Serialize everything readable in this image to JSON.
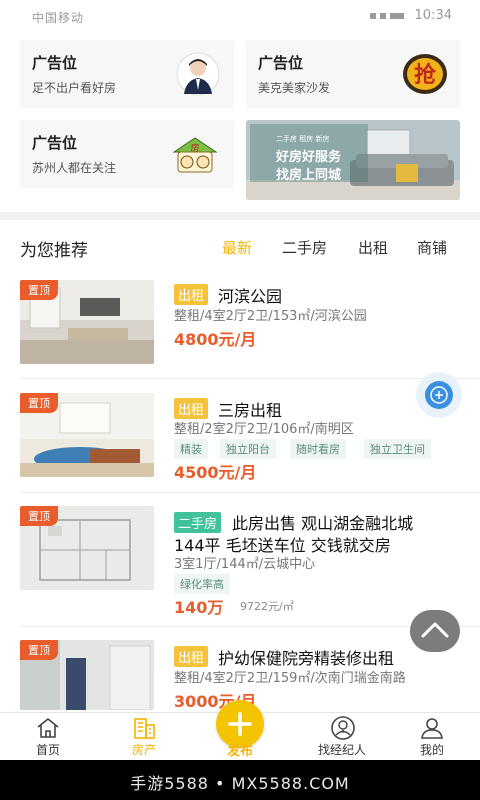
{
  "status_bar": {
    "left_text": "中国移动",
    "time": "10:34"
  },
  "ads": [
    {
      "title": "广告位",
      "subtitle": "足不出户看好房",
      "icon": "agent-portrait-icon"
    },
    {
      "title": "广告位",
      "subtitle": "美克美家沙发",
      "icon": "grab-badge-icon",
      "badge_char": "抢"
    },
    {
      "title": "广告位",
      "subtitle": "苏州人都在关注",
      "icon": "house-emoji-icon",
      "badge_char": "房"
    },
    {
      "banner_tags": "二手房  租房  新房",
      "banner_line1": "好房好服务",
      "banner_line2": "找房上同城"
    }
  ],
  "recommend": {
    "title": "为您推荐",
    "tabs": [
      "最新",
      "二手房",
      "出租",
      "商铺"
    ],
    "active_tab": 0
  },
  "listings": [
    {
      "top_tag": "置顶",
      "badge": "出租",
      "badge_type": "rent",
      "title": "河滨公园",
      "desc": "整租/4室2厅2卫/153㎡/河滨公园",
      "tags": [],
      "price": "4800元/月",
      "unit_price": ""
    },
    {
      "top_tag": "置顶",
      "badge": "出租",
      "badge_type": "rent",
      "title": "三房出租",
      "desc": "整租/2室2厅2卫/106㎡/南明区",
      "tags": [
        "精装",
        "独立阳台",
        "随时看房",
        "独立卫生间"
      ],
      "price": "4500元/月",
      "unit_price": ""
    },
    {
      "top_tag": "置顶",
      "badge": "二手房",
      "badge_type": "sale",
      "title": "此房出售 观山湖金融北城",
      "title_line2": "144平 毛坯送车位 交钱就交房",
      "desc": "3室1厅/144㎡/云城中心",
      "tags": [
        "绿化率高"
      ],
      "price": "140万",
      "unit_price": "9722元/㎡"
    },
    {
      "top_tag": "置顶",
      "badge": "出租",
      "badge_type": "rent",
      "title": "护幼保健院旁精装修出租",
      "desc": "整租/4室2厅2卫/159㎡/次南门瑞金南路",
      "tags": [],
      "price": "3000元/月",
      "unit_price": ""
    }
  ],
  "bottom_nav": {
    "items": [
      {
        "label": "首页",
        "icon": "home-icon"
      },
      {
        "label": "房产",
        "icon": "building-icon"
      },
      {
        "label": "发布",
        "icon": "plus-icon"
      },
      {
        "label": "找经纪人",
        "icon": "agent-icon"
      },
      {
        "label": "我的",
        "icon": "user-icon"
      }
    ],
    "active": 1
  },
  "watermark": "手游5588 • MX5588.COM",
  "colors": {
    "accent": "#f5b400",
    "price": "#e95c2b",
    "top_tag": "#e95c2b",
    "rent_badge": "#f5c33b",
    "sale_badge": "#40c29b"
  }
}
